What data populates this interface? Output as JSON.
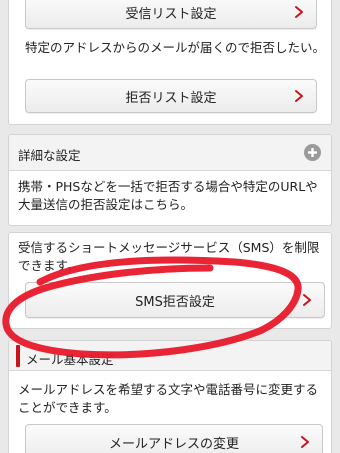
{
  "receive_section": {
    "receive_list_button": "受信リスト設定",
    "description": "特定のアドレスからのメールが届くので拒否したい。",
    "reject_list_button": "拒否リスト設定"
  },
  "detail_section": {
    "title": "詳細な設定",
    "description": "携帯・PHSなどを一括で拒否する場合や特定のURLや大量送信の拒否設定はこちら。"
  },
  "sms_section": {
    "description": "受信するショートメッセージサービス（SMS）を制限できます。",
    "sms_reject_button": "SMS拒否設定"
  },
  "mail_basic_section": {
    "title": "メール基本設定",
    "description": "メールアドレスを希望する文字や電話番号に変更することができます。",
    "change_address_button": "メールアドレスの変更"
  },
  "colors": {
    "accent_red": "#c8151b",
    "annotation_red": "#e8182a"
  },
  "icons": {
    "chevron": "chevron-right-icon",
    "expand": "plus-circle-icon"
  }
}
